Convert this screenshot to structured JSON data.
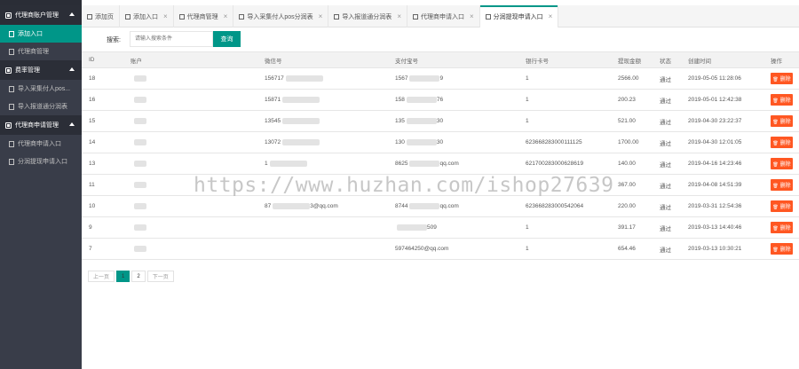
{
  "sidebar": {
    "groups": [
      {
        "label": "代理商账户管理",
        "items": [
          {
            "label": "添加入口",
            "active": true
          },
          {
            "label": "代理商管理",
            "active": false
          }
        ]
      },
      {
        "label": "费率管理",
        "items": [
          {
            "label": "导入采集付人pos...",
            "active": false
          },
          {
            "label": "导入报道通分润表",
            "active": false
          }
        ]
      },
      {
        "label": "代理商申请管理",
        "items": [
          {
            "label": "代理商申请入口",
            "active": false
          },
          {
            "label": "分润提现申请入口",
            "active": false
          }
        ]
      }
    ]
  },
  "tabs": [
    {
      "label": "添加页",
      "active": false,
      "closable": false
    },
    {
      "label": "添加入口",
      "active": false,
      "closable": true
    },
    {
      "label": "代理商管理",
      "active": false,
      "closable": true
    },
    {
      "label": "导入采集付人pos分润表",
      "active": false,
      "closable": true
    },
    {
      "label": "导入报道通分润表",
      "active": false,
      "closable": true
    },
    {
      "label": "代理商申请入口",
      "active": false,
      "closable": true
    },
    {
      "label": "分润提现申请入口",
      "active": true,
      "closable": true
    }
  ],
  "search": {
    "label": "搜索:",
    "placeholder": "请输入搜索条件",
    "button_label": "查询"
  },
  "table": {
    "headers": [
      "ID",
      "账户",
      "微信号",
      "支付宝号",
      "银行卡号",
      "提现金额",
      "状态",
      "创建时间",
      "操作"
    ],
    "rows": [
      {
        "id": "18",
        "name": "",
        "wechat": "156717",
        "alipay": "1567",
        "alipay_tail": "9",
        "bank": "1",
        "amount": "2566.00",
        "status": "通过",
        "created": "2019-05-05 11:28:06"
      },
      {
        "id": "16",
        "name": "",
        "wechat": "15871",
        "alipay": "158",
        "alipay_tail": "76",
        "bank": "1",
        "amount": "200.23",
        "status": "通过",
        "created": "2019-05-01 12:42:38"
      },
      {
        "id": "15",
        "name": "",
        "wechat": "13545",
        "alipay": "135",
        "alipay_tail": "30",
        "bank": "1",
        "amount": "521.00",
        "status": "通过",
        "created": "2019-04-30 23:22:37"
      },
      {
        "id": "14",
        "name": "",
        "wechat": "13072",
        "alipay": "130",
        "alipay_tail": "30",
        "bank": "623668283000111125",
        "amount": "1700.00",
        "status": "通过",
        "created": "2019-04-30 12:01:05"
      },
      {
        "id": "13",
        "name": "",
        "wechat": "1",
        "alipay": "8625",
        "alipay_tail": "qq.com",
        "bank": "621700283000628619",
        "amount": "140.00",
        "status": "通过",
        "created": "2019-04-16 14:23:46"
      },
      {
        "id": "11",
        "name": "",
        "wechat": "",
        "alipay": "",
        "alipay_tail": "",
        "bank": "",
        "amount": "367.00",
        "status": "通过",
        "created": "2019-04-08 14:51:39"
      },
      {
        "id": "10",
        "name": "",
        "wechat": "87",
        "wechat_tail": "3@qq.com",
        "alipay": "8744",
        "alipay_tail": "qq.com",
        "bank": "623668283000542064",
        "amount": "220.00",
        "status": "通过",
        "created": "2019-03-31 12:54:36"
      },
      {
        "id": "9",
        "name": "",
        "wechat": "",
        "alipay": "",
        "alipay_tail": "509",
        "bank": "1",
        "amount": "391.17",
        "status": "通过",
        "created": "2019-03-13 14:40:46"
      },
      {
        "id": "7",
        "name": "",
        "wechat": "",
        "alipay": "597464250@qq.com",
        "alipay_tail": "",
        "bank": "1",
        "amount": "654.46",
        "status": "通过",
        "created": "2019-03-13 10:30:21"
      }
    ],
    "delete_label": "删除"
  },
  "pager": {
    "prev": "上一页",
    "pages": [
      "1",
      "2"
    ],
    "current": "1",
    "next": "下一页"
  },
  "watermark": "https://www.huzhan.com/ishop27639",
  "colors": {
    "primary": "#009688",
    "danger": "#ff5722",
    "sidebar": "#393d49"
  }
}
